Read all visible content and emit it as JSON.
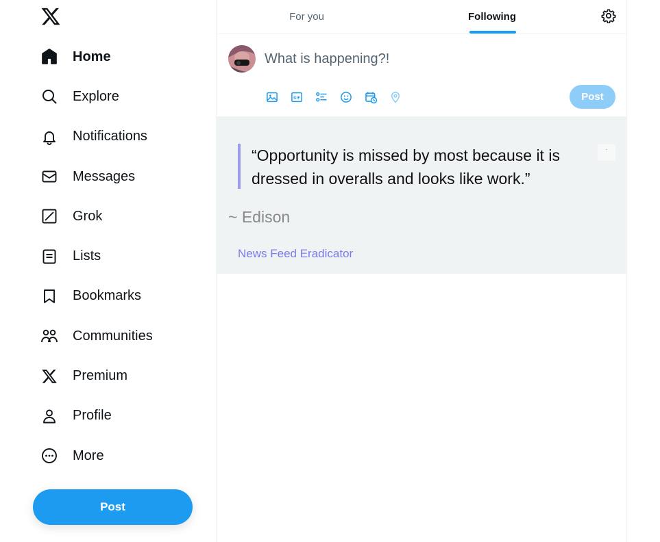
{
  "app": {
    "name": "X"
  },
  "icons": {
    "logo": "x-logo-icon",
    "accent": "#1d9bf0"
  },
  "sidebar": {
    "items": [
      {
        "label": "Home",
        "icon": "home-icon",
        "active": true
      },
      {
        "label": "Explore",
        "icon": "search-icon"
      },
      {
        "label": "Notifications",
        "icon": "bell-icon"
      },
      {
        "label": "Messages",
        "icon": "envelope-icon"
      },
      {
        "label": "Grok",
        "icon": "grok-icon"
      },
      {
        "label": "Lists",
        "icon": "list-icon"
      },
      {
        "label": "Bookmarks",
        "icon": "bookmark-icon"
      },
      {
        "label": "Communities",
        "icon": "people-icon"
      },
      {
        "label": "Premium",
        "icon": "x-logo-icon"
      },
      {
        "label": "Profile",
        "icon": "person-icon"
      },
      {
        "label": "More",
        "icon": "more-circle-icon"
      }
    ],
    "post_label": "Post"
  },
  "tabs": {
    "for_you": "For you",
    "following": "Following",
    "selected": "Following"
  },
  "composer": {
    "placeholder": "What is happening?!",
    "post_label": "Post",
    "tools": [
      "image-icon",
      "gif-icon",
      "poll-icon",
      "emoji-icon",
      "schedule-icon",
      "location-icon"
    ]
  },
  "quote_panel": {
    "quote": "“Opportunity is missed by most because it is dressed in overalls and looks like work.”",
    "author": "~ Edison",
    "source": "News Feed Eradicator",
    "settings_glyph": "·"
  }
}
